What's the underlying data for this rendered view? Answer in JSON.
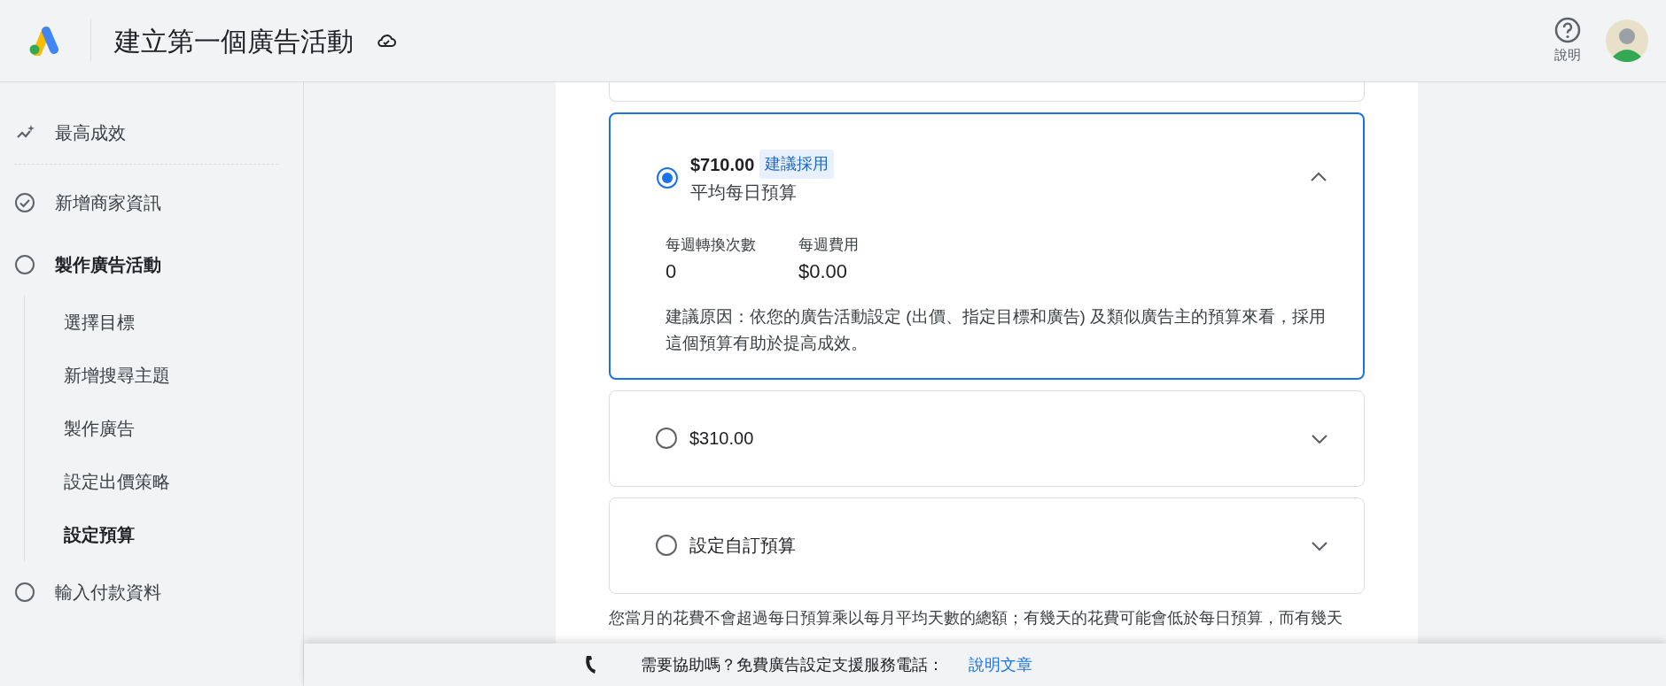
{
  "header": {
    "title": "建立第一個廣告活動",
    "help_label": "說明"
  },
  "sidebar": {
    "top_item": {
      "label": "最高成效"
    },
    "steps": [
      {
        "label": "新增商家資訊",
        "completed": true,
        "current": false
      },
      {
        "label": "製作廣告活動",
        "completed": false,
        "current": true,
        "children": [
          {
            "label": "選擇目標",
            "selected": false
          },
          {
            "label": "新增搜尋主題",
            "selected": false
          },
          {
            "label": "製作廣告",
            "selected": false
          },
          {
            "label": "設定出價策略",
            "selected": false
          },
          {
            "label": "設定預算",
            "selected": true
          }
        ]
      },
      {
        "label": "輸入付款資料",
        "completed": false,
        "current": false
      }
    ]
  },
  "budget_options": [
    {
      "title": "$710.00",
      "badge": "建議採用",
      "subtitle": "平均每日預算",
      "selected": true,
      "expanded": true,
      "metrics": [
        {
          "label": "每週轉換次數",
          "value": "0"
        },
        {
          "label": "每週費用",
          "value": "$0.00"
        }
      ],
      "reason": "建議原因：依您的廣告活動設定 (出價、指定目標和廣告) 及類似廣告主的預算來看，採用這個預算有助於提高成效。"
    },
    {
      "title": "$310.00",
      "selected": false,
      "expanded": false
    },
    {
      "title": "設定自訂預算",
      "selected": false,
      "expanded": false
    }
  ],
  "note": "您當月的花費不會超過每日預算乘以每月平均天數的總額；有幾天的花費可能會低於每日預算，而有幾天",
  "footer": {
    "text": "需要協助嗎？免費廣告設定支援服務電話：",
    "link": "說明文章"
  }
}
